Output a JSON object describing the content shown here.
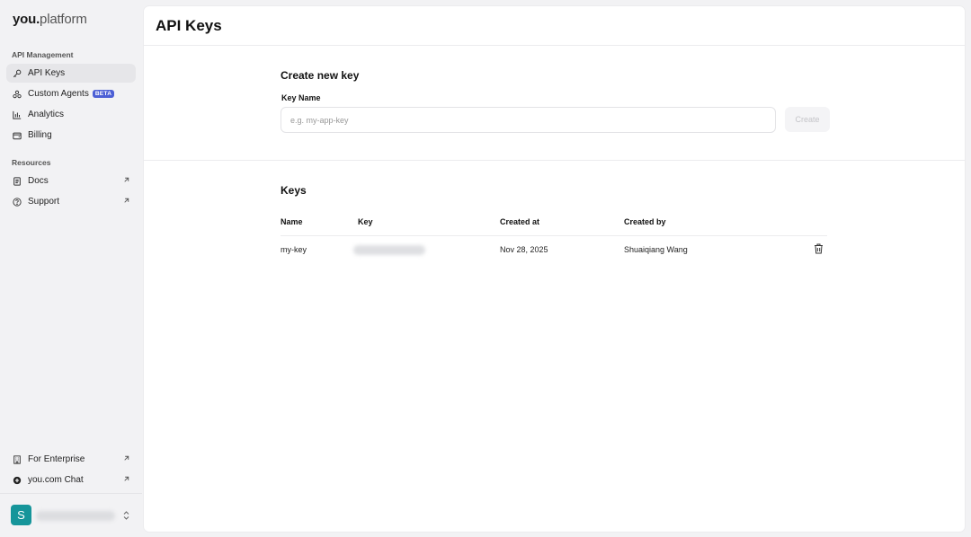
{
  "sidebar": {
    "logo_bold": "you.",
    "logo_light": "platform",
    "api_management_label": "API Management",
    "nav": [
      {
        "label": "API Keys",
        "icon": "key-icon"
      },
      {
        "label": "Custom Agents",
        "icon": "agents-icon",
        "badge": "BETA"
      },
      {
        "label": "Analytics",
        "icon": "bar-chart-icon"
      },
      {
        "label": "Billing",
        "icon": "wallet-icon"
      }
    ],
    "resources_label": "Resources",
    "resources": [
      {
        "label": "Docs",
        "icon": "document-icon"
      },
      {
        "label": "Support",
        "icon": "help-circle-icon"
      }
    ],
    "bottom": [
      {
        "label": "For Enterprise",
        "icon": "building-icon"
      },
      {
        "label": "you.com Chat",
        "icon": "chat-icon"
      }
    ],
    "account": {
      "avatar_initial": "S"
    }
  },
  "main": {
    "title": "API Keys",
    "create": {
      "heading": "Create new key",
      "field_label": "Key Name",
      "placeholder": "e.g. my-app-key",
      "button": "Create"
    },
    "keys": {
      "heading": "Keys",
      "columns": [
        "Name",
        "Key",
        "Created at",
        "Created by"
      ],
      "rows": [
        {
          "name": "my-key",
          "created_at": "Nov 28, 2025",
          "created_by": "Shuaiqiang Wang"
        }
      ]
    }
  },
  "colors": {
    "accent_badge": "#4c5fd5",
    "avatar": "#16959a",
    "sidebar_bg": "#f2f2f4",
    "active_nav_bg": "#e6e6e9"
  }
}
